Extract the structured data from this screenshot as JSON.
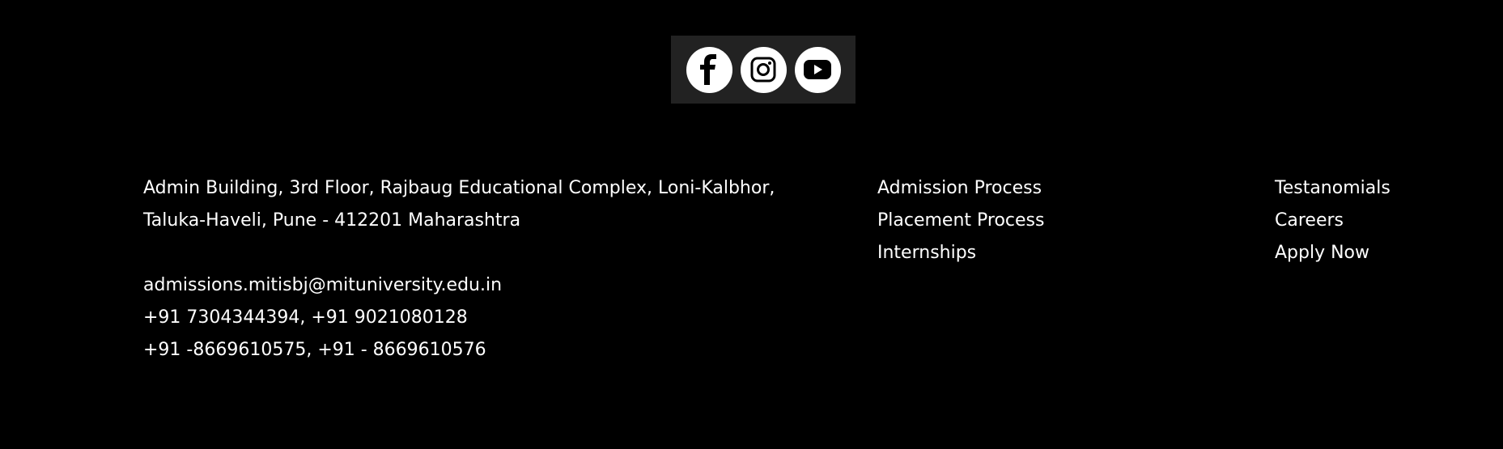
{
  "social": {
    "facebook_icon": "facebook-icon",
    "instagram_icon": "instagram-icon",
    "youtube_icon": "youtube-icon"
  },
  "contact": {
    "address_line1": "Admin Building, 3rd Floor, Rajbaug Educational Complex, Loni-Kalbhor,",
    "address_line2": "Taluka-Haveli, Pune - 412201 Maharashtra",
    "email": "admissions.mitisbj@mituniversity.edu.in",
    "phone1": "+91 7304344394, +91 9021080128",
    "phone2": "+91 -8669610575, +91 - 8669610576"
  },
  "links_col1": [
    {
      "label": "Admission Process"
    },
    {
      "label": "Placement Process"
    },
    {
      "label": "Internships"
    }
  ],
  "links_col2": [
    {
      "label": "Testanomials"
    },
    {
      "label": "Careers"
    },
    {
      "label": "Apply Now"
    }
  ],
  "colors": {
    "background": "#000000",
    "social_bar": "#222222",
    "text": "#ffffff"
  }
}
